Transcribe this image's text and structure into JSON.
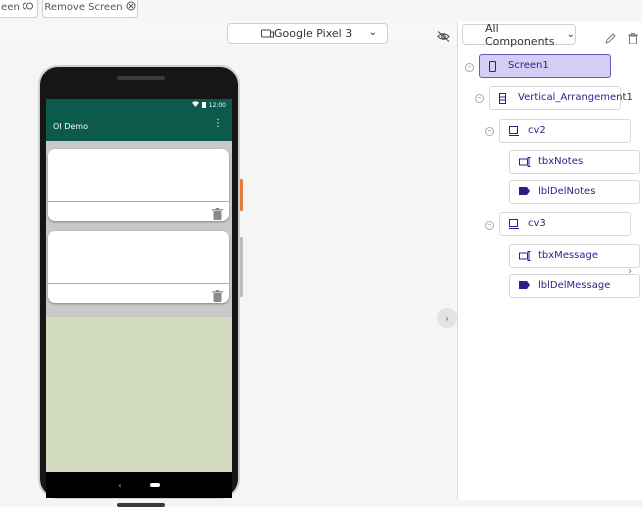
{
  "toolbar": {
    "screen_button_label": "een",
    "screen_button_icon": "toggle-circle",
    "remove_screen_label": "Remove Screen",
    "remove_screen_icon": "close-circle"
  },
  "viewer": {
    "device_label": "Google Pixel 3",
    "device_icon": "tablet",
    "hide_icon": "eye-off"
  },
  "phone": {
    "status_time": "12:00",
    "app_title": "OI Demo",
    "cards": [
      {
        "name": "card-notes"
      },
      {
        "name": "card-message"
      }
    ],
    "background_color": "#d2dac0",
    "appbar_color": "#0b5a4c"
  },
  "components_panel": {
    "filter_label": "All Components",
    "tree": [
      {
        "label": "Screen1",
        "type": "screen",
        "selected": true
      },
      {
        "label": "Vertical_Arrangement1",
        "type": "vertical"
      },
      {
        "label": "cv2",
        "type": "card"
      },
      {
        "label": "tbxNotes",
        "type": "textbox"
      },
      {
        "label": "lblDelNotes",
        "type": "label"
      },
      {
        "label": "cv3",
        "type": "card"
      },
      {
        "label": "tbxMessage",
        "type": "textbox"
      },
      {
        "label": "lblDelMessage",
        "type": "label"
      }
    ],
    "accent_color": "#2c1e8a"
  }
}
